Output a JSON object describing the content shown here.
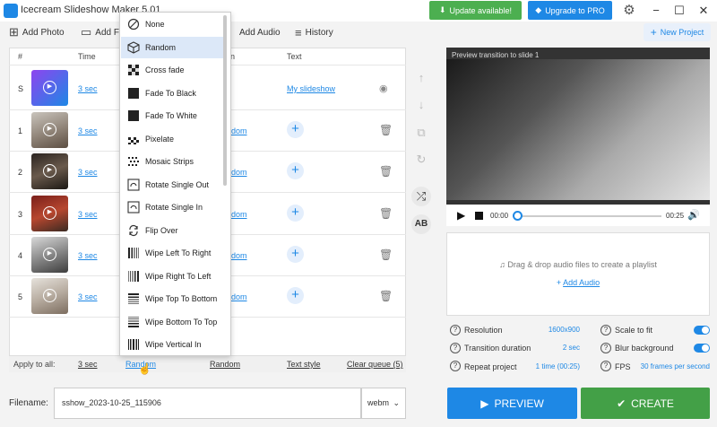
{
  "window": {
    "title": "Icecream Slideshow Maker 5.01"
  },
  "header": {
    "update_label": "Update available!",
    "pro_label": "Upgrade to PRO"
  },
  "toolbar": {
    "add_photo": "Add Photo",
    "add_f": "Add F",
    "add_audio": "Add Audio",
    "history": "History",
    "new_project": "New Project"
  },
  "table": {
    "headers": {
      "num": "#",
      "time": "Time",
      "transition": "n",
      "text": "Text"
    },
    "rows": [
      {
        "num": "S",
        "time": "3 sec",
        "text": "My slideshow"
      },
      {
        "num": "1",
        "time": "3 sec",
        "transition": "ndom"
      },
      {
        "num": "2",
        "time": "3 sec",
        "transition": "ndom"
      },
      {
        "num": "3",
        "time": "3 sec",
        "transition": "ndom"
      },
      {
        "num": "4",
        "time": "3 sec",
        "transition": "ndom"
      },
      {
        "num": "5",
        "time": "3 sec",
        "transition": "ndom"
      }
    ]
  },
  "apply_all": {
    "label": "Apply to all:",
    "time": "3 sec",
    "transition": "Random",
    "transition2": "Random",
    "text_style": "Text style",
    "clear_queue": "Clear queue (5)"
  },
  "dropdown": {
    "items": [
      "None",
      "Random",
      "Cross fade",
      "Fade To Black",
      "Fade To White",
      "Pixelate",
      "Mosaic Strips",
      "Rotate Single Out",
      "Rotate Single In",
      "Flip Over",
      "Wipe Left To Right",
      "Wipe Right To Left",
      "Wipe Top To Bottom",
      "Wipe Bottom To Top",
      "Wipe Vertical In"
    ],
    "selected": "Random"
  },
  "preview": {
    "label": "Preview transition to slide 1",
    "time_current": "00:00",
    "time_total": "00:25"
  },
  "audio": {
    "drop_text": "Drag & drop audio files to create a playlist",
    "add_label": "Add Audio"
  },
  "settings": {
    "resolution": {
      "label": "Resolution",
      "value": "1600x900"
    },
    "transition_duration": {
      "label": "Transition duration",
      "value": "2 sec"
    },
    "repeat_project": {
      "label": "Repeat project",
      "value": "1 time (00:25)"
    },
    "scale_to_fit": {
      "label": "Scale to fit",
      "on": true
    },
    "blur_background": {
      "label": "Blur background",
      "on": true
    },
    "fps": {
      "label": "FPS",
      "value": "30 frames per second"
    }
  },
  "footer": {
    "filename_label": "Filename:",
    "filename": "sshow_2023-10-25_115906",
    "format": "webm",
    "preview_label": "PREVIEW",
    "create_label": "CREATE"
  },
  "colors": {
    "accent": "#1e88e5",
    "green": "#43a047"
  }
}
